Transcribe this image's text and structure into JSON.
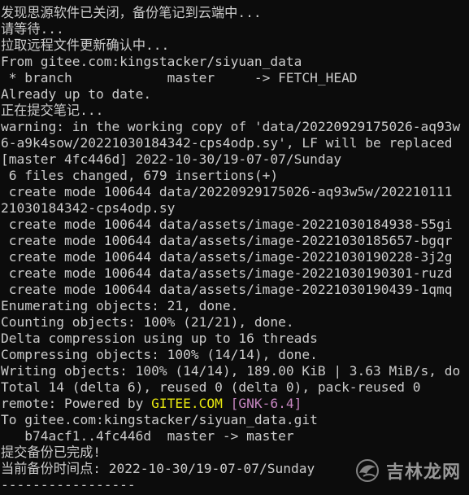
{
  "terminal": {
    "lines": [
      "发现思源软件已关闭，备份笔记到云端中...",
      "请等待...",
      "拉取远程文件更新确认中...",
      "From gitee.com:kingstacker/siyuan_data",
      " * branch            master     -> FETCH_HEAD",
      "Already up to date.",
      "正在提交笔记...",
      "warning: in the working copy of 'data/20220929175026-aq93w",
      "6-a9k4sow/20221030184342-cps4odp.sy', LF will be replaced",
      "[master 4fc446d] 2022-10-30/19-07-07/Sunday",
      " 6 files changed, 679 insertions(+)",
      " create mode 100644 data/20220929175026-aq93w5w/202210111",
      "21030184342-cps4odp.sy",
      " create mode 100644 data/assets/image-20221030184938-55gi",
      " create mode 100644 data/assets/image-20221030185657-bgqr",
      " create mode 100644 data/assets/image-20221030190228-3j2g",
      " create mode 100644 data/assets/image-20221030190301-ruzd",
      " create mode 100644 data/assets/image-20221030190439-1qmq",
      "Enumerating objects: 21, done.",
      "Counting objects: 100% (21/21), done.",
      "Delta compression using up to 16 threads",
      "Compressing objects: 100% (14/14), done.",
      "Writing objects: 100% (14/14), 189.00 KiB | 3.63 MiB/s, do",
      "Total 14 (delta 6), reused 0 (delta 0), pack-reused 0"
    ],
    "remote_prefix": "remote: Powered by ",
    "remote_gitee": "GITEE.COM",
    "remote_space": " ",
    "remote_gnk": "[GNK-6.4]",
    "lines_after": [
      "To gitee.com:kingstacker/siyuan_data.git",
      "   b74acf1..4fc446d  master -> master",
      "提交备份已完成!",
      "当前备份时间点: 2022-10-30/19-07-07/Sunday",
      "-----------------"
    ]
  },
  "watermark": {
    "text": "吉林龙网",
    "icon": "dragon-logo-icon"
  },
  "colors": {
    "background": "#0c0c0c",
    "text": "#cccccc",
    "gitee": "#e5e510",
    "gnk": "#c586c0"
  }
}
